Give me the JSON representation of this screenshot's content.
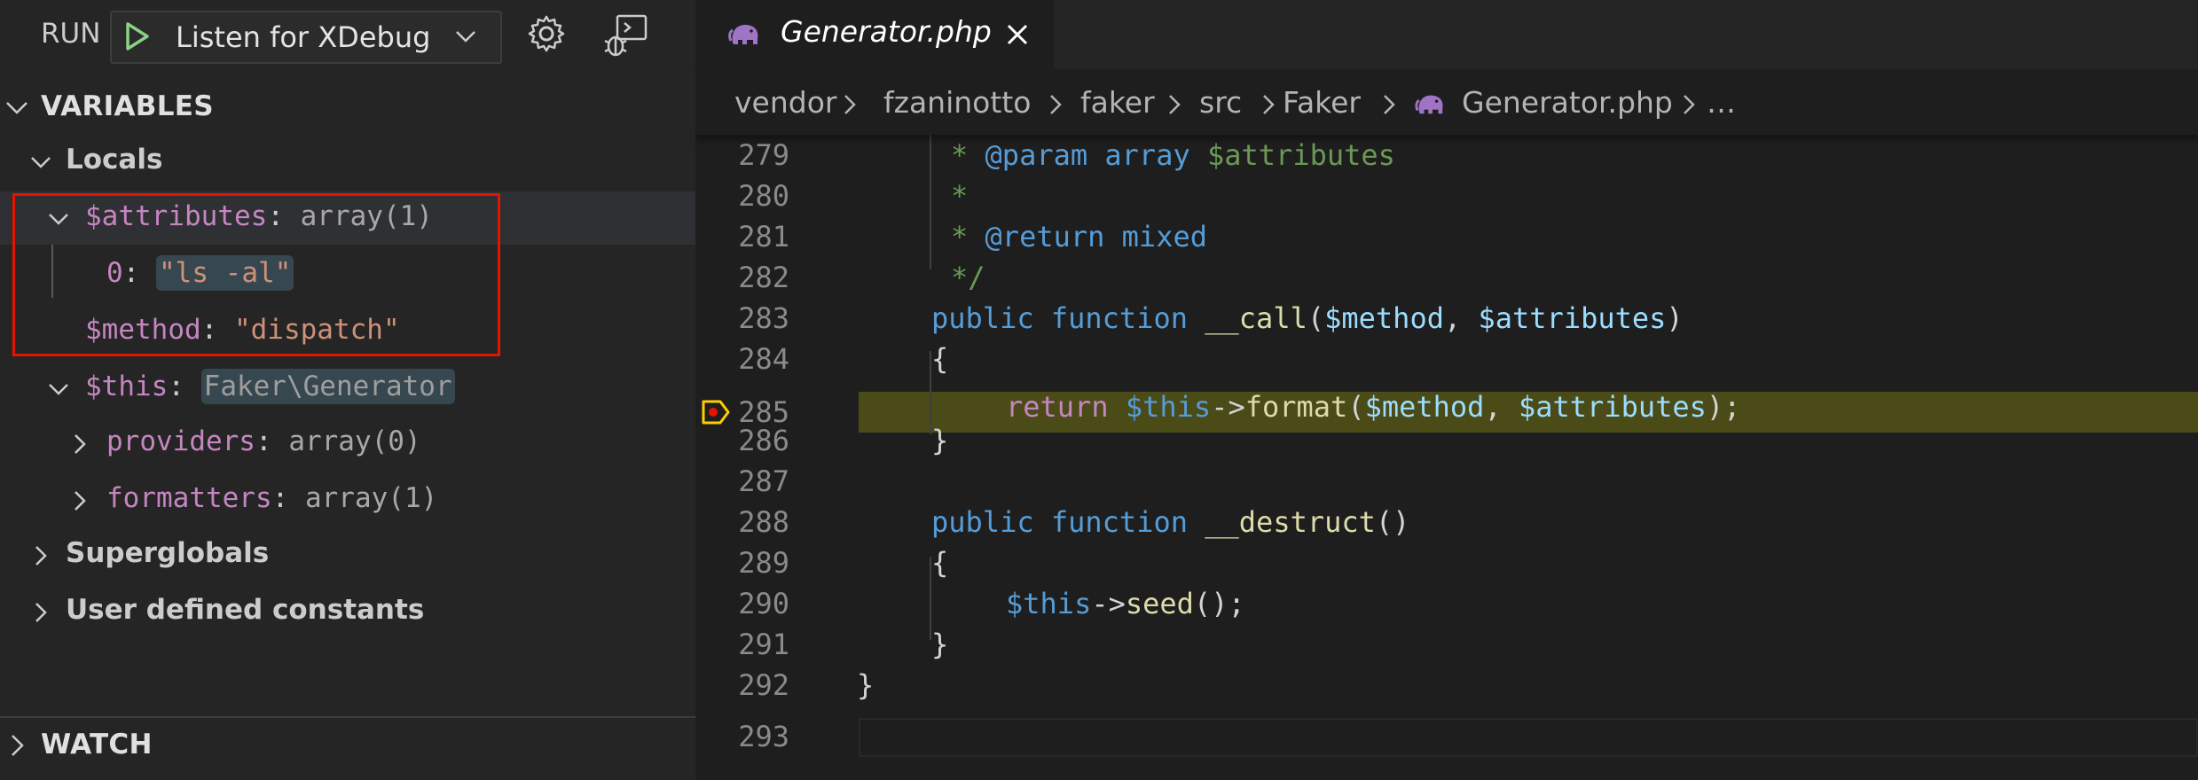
{
  "debug_toolbar": {
    "run_label": "RUN",
    "configuration": "Listen for XDebug",
    "play_icon": "play-icon",
    "settings_icon": "gear-icon",
    "console_icon": "debug-console-icon"
  },
  "variables": {
    "header": "VARIABLES",
    "locals_label": "Locals",
    "items": [
      {
        "name": "$attributes",
        "value": "array(1)"
      },
      {
        "key": "0",
        "value": "\"ls -al\""
      },
      {
        "name": "$method",
        "value": "\"dispatch\""
      },
      {
        "name": "$this",
        "value": "Faker\\Generator"
      },
      {
        "name": "providers",
        "value": "array(0)"
      },
      {
        "name": "formatters",
        "value": "array(1)"
      }
    ],
    "superglobals_label": "Superglobals",
    "constants_label": "User defined constants"
  },
  "watch": {
    "header": "WATCH"
  },
  "editor": {
    "tab_title": "Generator.php",
    "breadcrumb": [
      "vendor",
      "fzaninotto",
      "faker",
      "src",
      "Faker",
      "Generator.php",
      "…"
    ],
    "current_line": 285,
    "line_numbers": [
      "279",
      "280",
      "281",
      "282",
      "283",
      "284",
      "285",
      "286",
      "287",
      "288",
      "289",
      "290",
      "291",
      "292",
      "293"
    ],
    "code": {
      "l279": {
        "star": "* ",
        "tag": "@param",
        "type": " array",
        "var": " $attributes"
      },
      "l280": "*",
      "l281": {
        "star": "* ",
        "tag": "@return",
        "type": " mixed"
      },
      "l282": "*/",
      "l283": {
        "kw1": "public",
        "kw2": "function",
        "fn": "__call",
        "p1": "$method",
        "p2": "$attributes"
      },
      "l284": "{",
      "l285": {
        "ret": "return",
        "this": "$this",
        "arrow": "->",
        "fn": "format",
        "p1": "$method",
        "p2": "$attributes"
      },
      "l286": "}",
      "l288": {
        "kw1": "public",
        "kw2": "function",
        "fn": "__destruct"
      },
      "l289": "{",
      "l290": {
        "this": "$this",
        "arrow": "->",
        "fn": "seed"
      },
      "l291": "}",
      "l292": "}"
    }
  },
  "colors": {
    "breakpoint_line": "#4b4b18",
    "breakpoint_marker": "#ffcc00",
    "annotation_box": "#e51400"
  }
}
